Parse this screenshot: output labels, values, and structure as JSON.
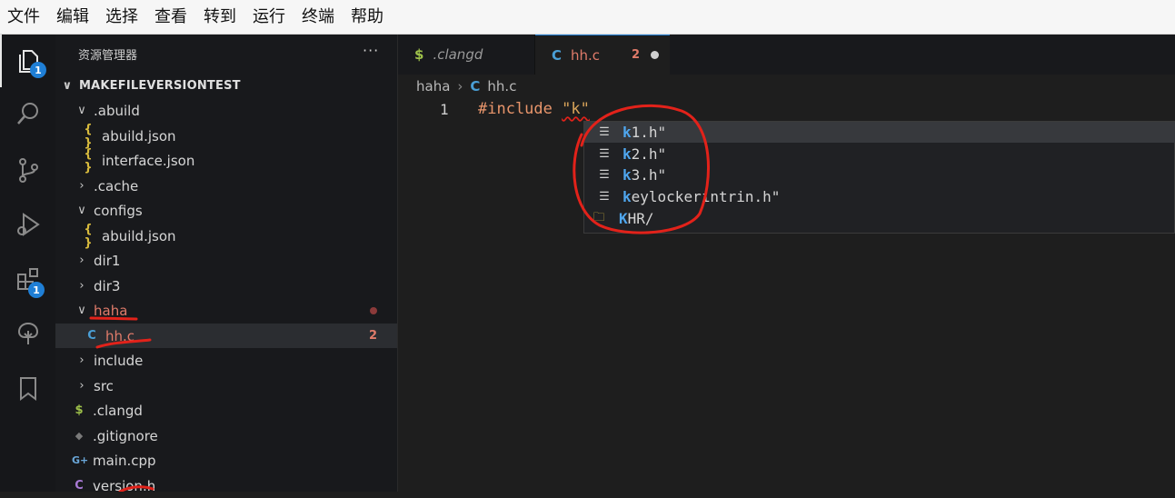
{
  "menubar": {
    "items": [
      "文件",
      "编辑",
      "选择",
      "查看",
      "转到",
      "运行",
      "终端",
      "帮助"
    ]
  },
  "activitybar": {
    "explorer_badge": "1",
    "extensions_badge": "1"
  },
  "sidebar": {
    "title": "资源管理器",
    "more": "···",
    "root_label": "MAKEFILEVERSIONTEST",
    "items": [
      {
        "label": ".abuild",
        "icon": ""
      },
      {
        "label": "abuild.json",
        "icon": "{ }"
      },
      {
        "label": "interface.json",
        "icon": "{ }"
      },
      {
        "label": ".cache",
        "icon": ""
      },
      {
        "label": "configs",
        "icon": ""
      },
      {
        "label": "abuild.json",
        "icon": "{ }"
      },
      {
        "label": "dir1",
        "icon": ""
      },
      {
        "label": "dir3",
        "icon": ""
      },
      {
        "label": "haha",
        "icon": ""
      },
      {
        "label": "hh.c",
        "icon": "C",
        "problems": "2"
      },
      {
        "label": "include",
        "icon": ""
      },
      {
        "label": "src",
        "icon": ""
      },
      {
        "label": ".clangd",
        "icon": "$"
      },
      {
        "label": ".gitignore",
        "icon": "◆"
      },
      {
        "label": "main.cpp",
        "icon": "G+"
      },
      {
        "label": "version.h",
        "icon": "C"
      }
    ]
  },
  "tabs": [
    {
      "icon": "$",
      "label": ".clangd"
    },
    {
      "icon": "C",
      "label": "hh.c",
      "problems": "2"
    }
  ],
  "breadcrumb": {
    "folder": "haha",
    "sep": "›",
    "file_icon": "C",
    "file": "hh.c"
  },
  "editor": {
    "line_number": "1",
    "directive": "#include",
    "string_open": "\"k\""
  },
  "suggest": {
    "items": [
      {
        "match": "k",
        "rest": "1.h\"",
        "icon": "file"
      },
      {
        "match": "k",
        "rest": "2.h\"",
        "icon": "file"
      },
      {
        "match": "k",
        "rest": "3.h\"",
        "icon": "file"
      },
      {
        "match": "k",
        "rest": "eylockerintrin.h\"",
        "icon": "file"
      },
      {
        "match": "K",
        "rest": "HR/",
        "icon": "folder"
      }
    ]
  },
  "colors": {
    "accent": "#1f7fd6",
    "annotation_red": "#e2221a",
    "highlight_match": "#4fa6ee",
    "modified_dot": "#8b3a3a"
  }
}
